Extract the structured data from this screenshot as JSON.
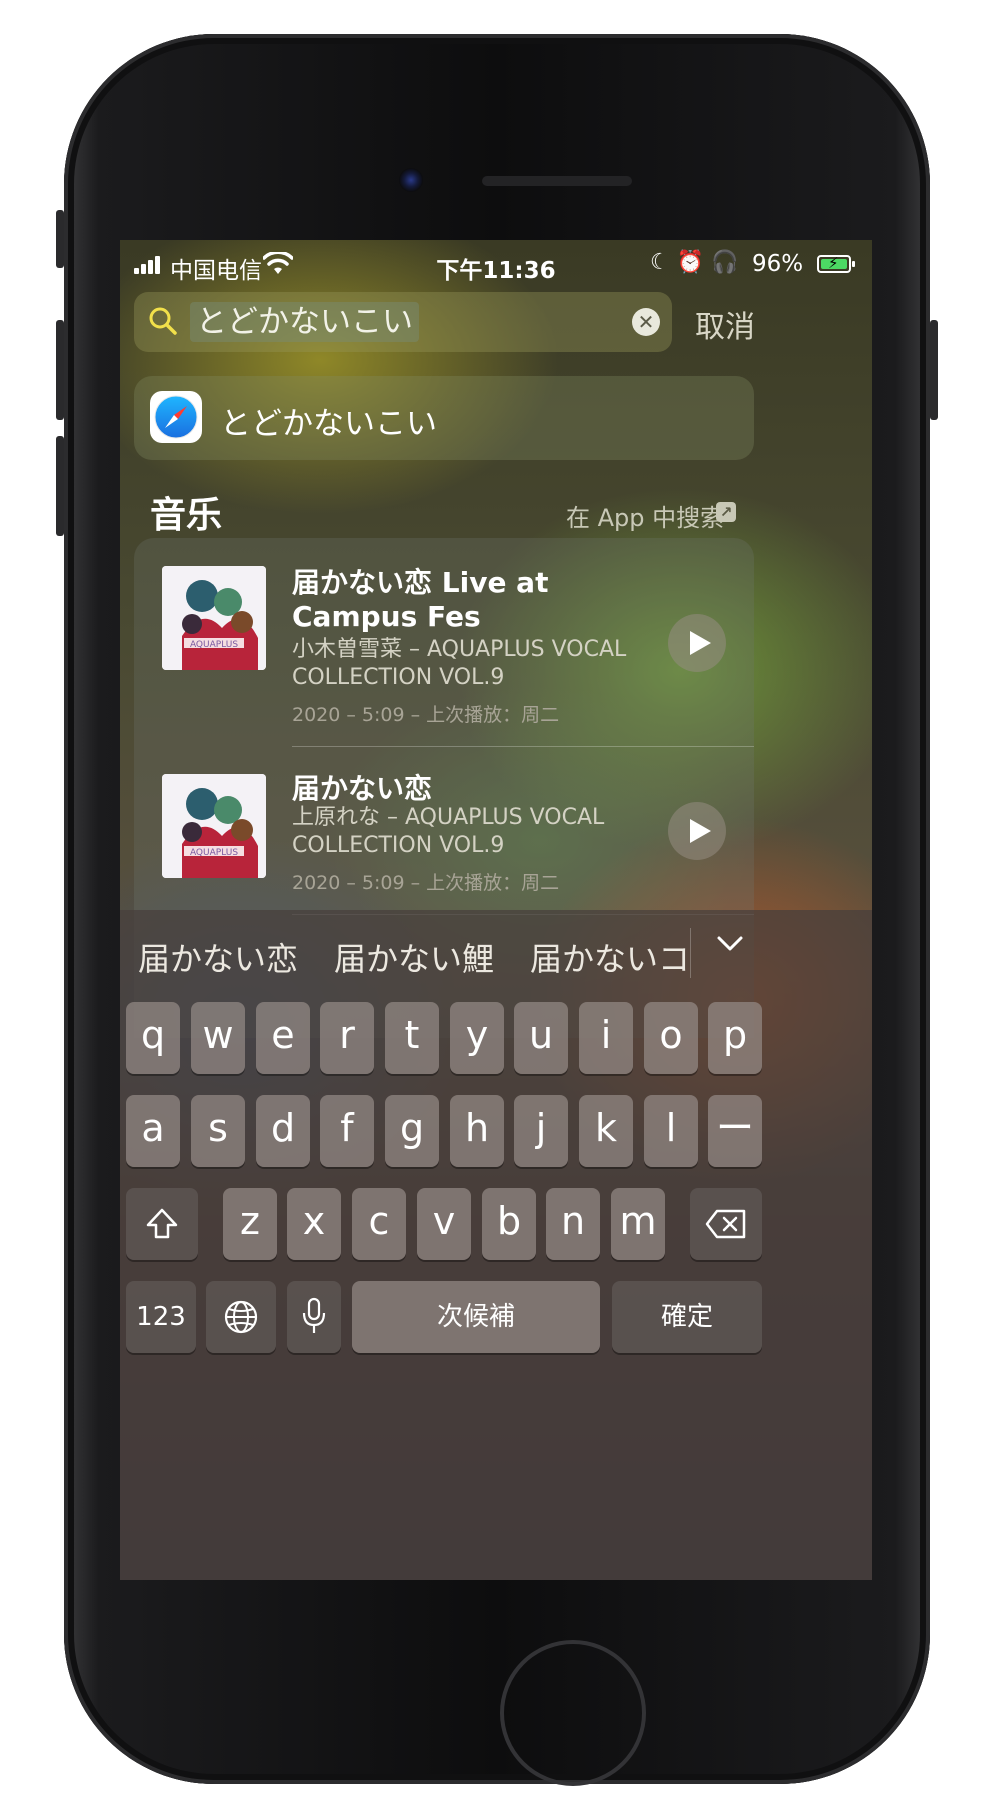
{
  "status_bar": {
    "carrier": "中国电信",
    "time": "下午11:36",
    "battery_percent": "96%",
    "status_icons": [
      "moon-icon",
      "alarm-icon",
      "headphones-icon"
    ]
  },
  "search": {
    "query": "とどかないこい",
    "cancel_label": "取消"
  },
  "top_suggestion": {
    "icon": "safari-icon",
    "label": "とどかないこい"
  },
  "music_section": {
    "title": "音乐",
    "search_in_app_label": "在 App 中搜索",
    "tracks": [
      {
        "title": "届かない恋 Live at Campus Fes",
        "subtitle": "小木曽雪菜 – AQUAPLUS VOCAL COLLECTION VOL.9",
        "meta": "2020 – 5:09 – 上次播放：周二",
        "art_label": "AQUAPLUS"
      },
      {
        "title": "届かない恋",
        "subtitle": "上原れな – AQUAPLUS VOCAL COLLECTION VOL.9",
        "meta": "2020 – 5:09 – 上次播放：周二",
        "art_label": "AQUAPLUS"
      }
    ]
  },
  "keyboard": {
    "candidates": [
      "届かない恋",
      "届かない鯉",
      "届かないコ"
    ],
    "row1": [
      "q",
      "w",
      "e",
      "r",
      "t",
      "y",
      "u",
      "i",
      "o",
      "p"
    ],
    "row2": [
      "a",
      "s",
      "d",
      "f",
      "g",
      "h",
      "j",
      "k",
      "l",
      "ー"
    ],
    "row3": [
      "z",
      "x",
      "c",
      "v",
      "b",
      "n",
      "m"
    ],
    "numbers_label": "123",
    "space_label": "次候補",
    "confirm_label": "確定"
  },
  "colors": {
    "battery_fill": "#4cd964",
    "search_icon": "#f2e04a"
  }
}
